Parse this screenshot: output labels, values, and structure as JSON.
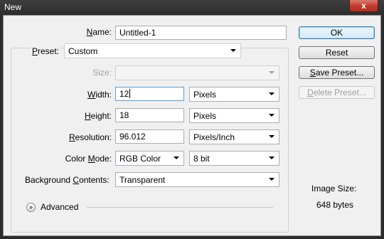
{
  "window": {
    "title": "New",
    "close_glyph": "x"
  },
  "form": {
    "name": {
      "label": "Name:",
      "value": "Untitled-1"
    },
    "preset": {
      "label": "Preset:",
      "value": "Custom"
    },
    "size": {
      "label": "Size:",
      "value": ""
    },
    "width": {
      "label": "Width:",
      "value": "12",
      "unit": "Pixels"
    },
    "height": {
      "label": "Height:",
      "value": "18",
      "unit": "Pixels"
    },
    "resolution": {
      "label": "Resolution:",
      "value": "96.012",
      "unit": "Pixels/Inch"
    },
    "color_mode": {
      "label": "Color Mode:",
      "value": "RGB Color",
      "depth": "8 bit"
    },
    "background": {
      "label": "Background Contents:",
      "value": "Transparent"
    },
    "advanced": {
      "label": "Advanced",
      "icon": "chevron-double-down-icon"
    }
  },
  "buttons": {
    "ok": "OK",
    "reset": "Reset",
    "save_preset": "Save Preset...",
    "delete_preset": "Delete Preset..."
  },
  "image_size": {
    "label": "Image Size:",
    "value": "648 bytes"
  }
}
